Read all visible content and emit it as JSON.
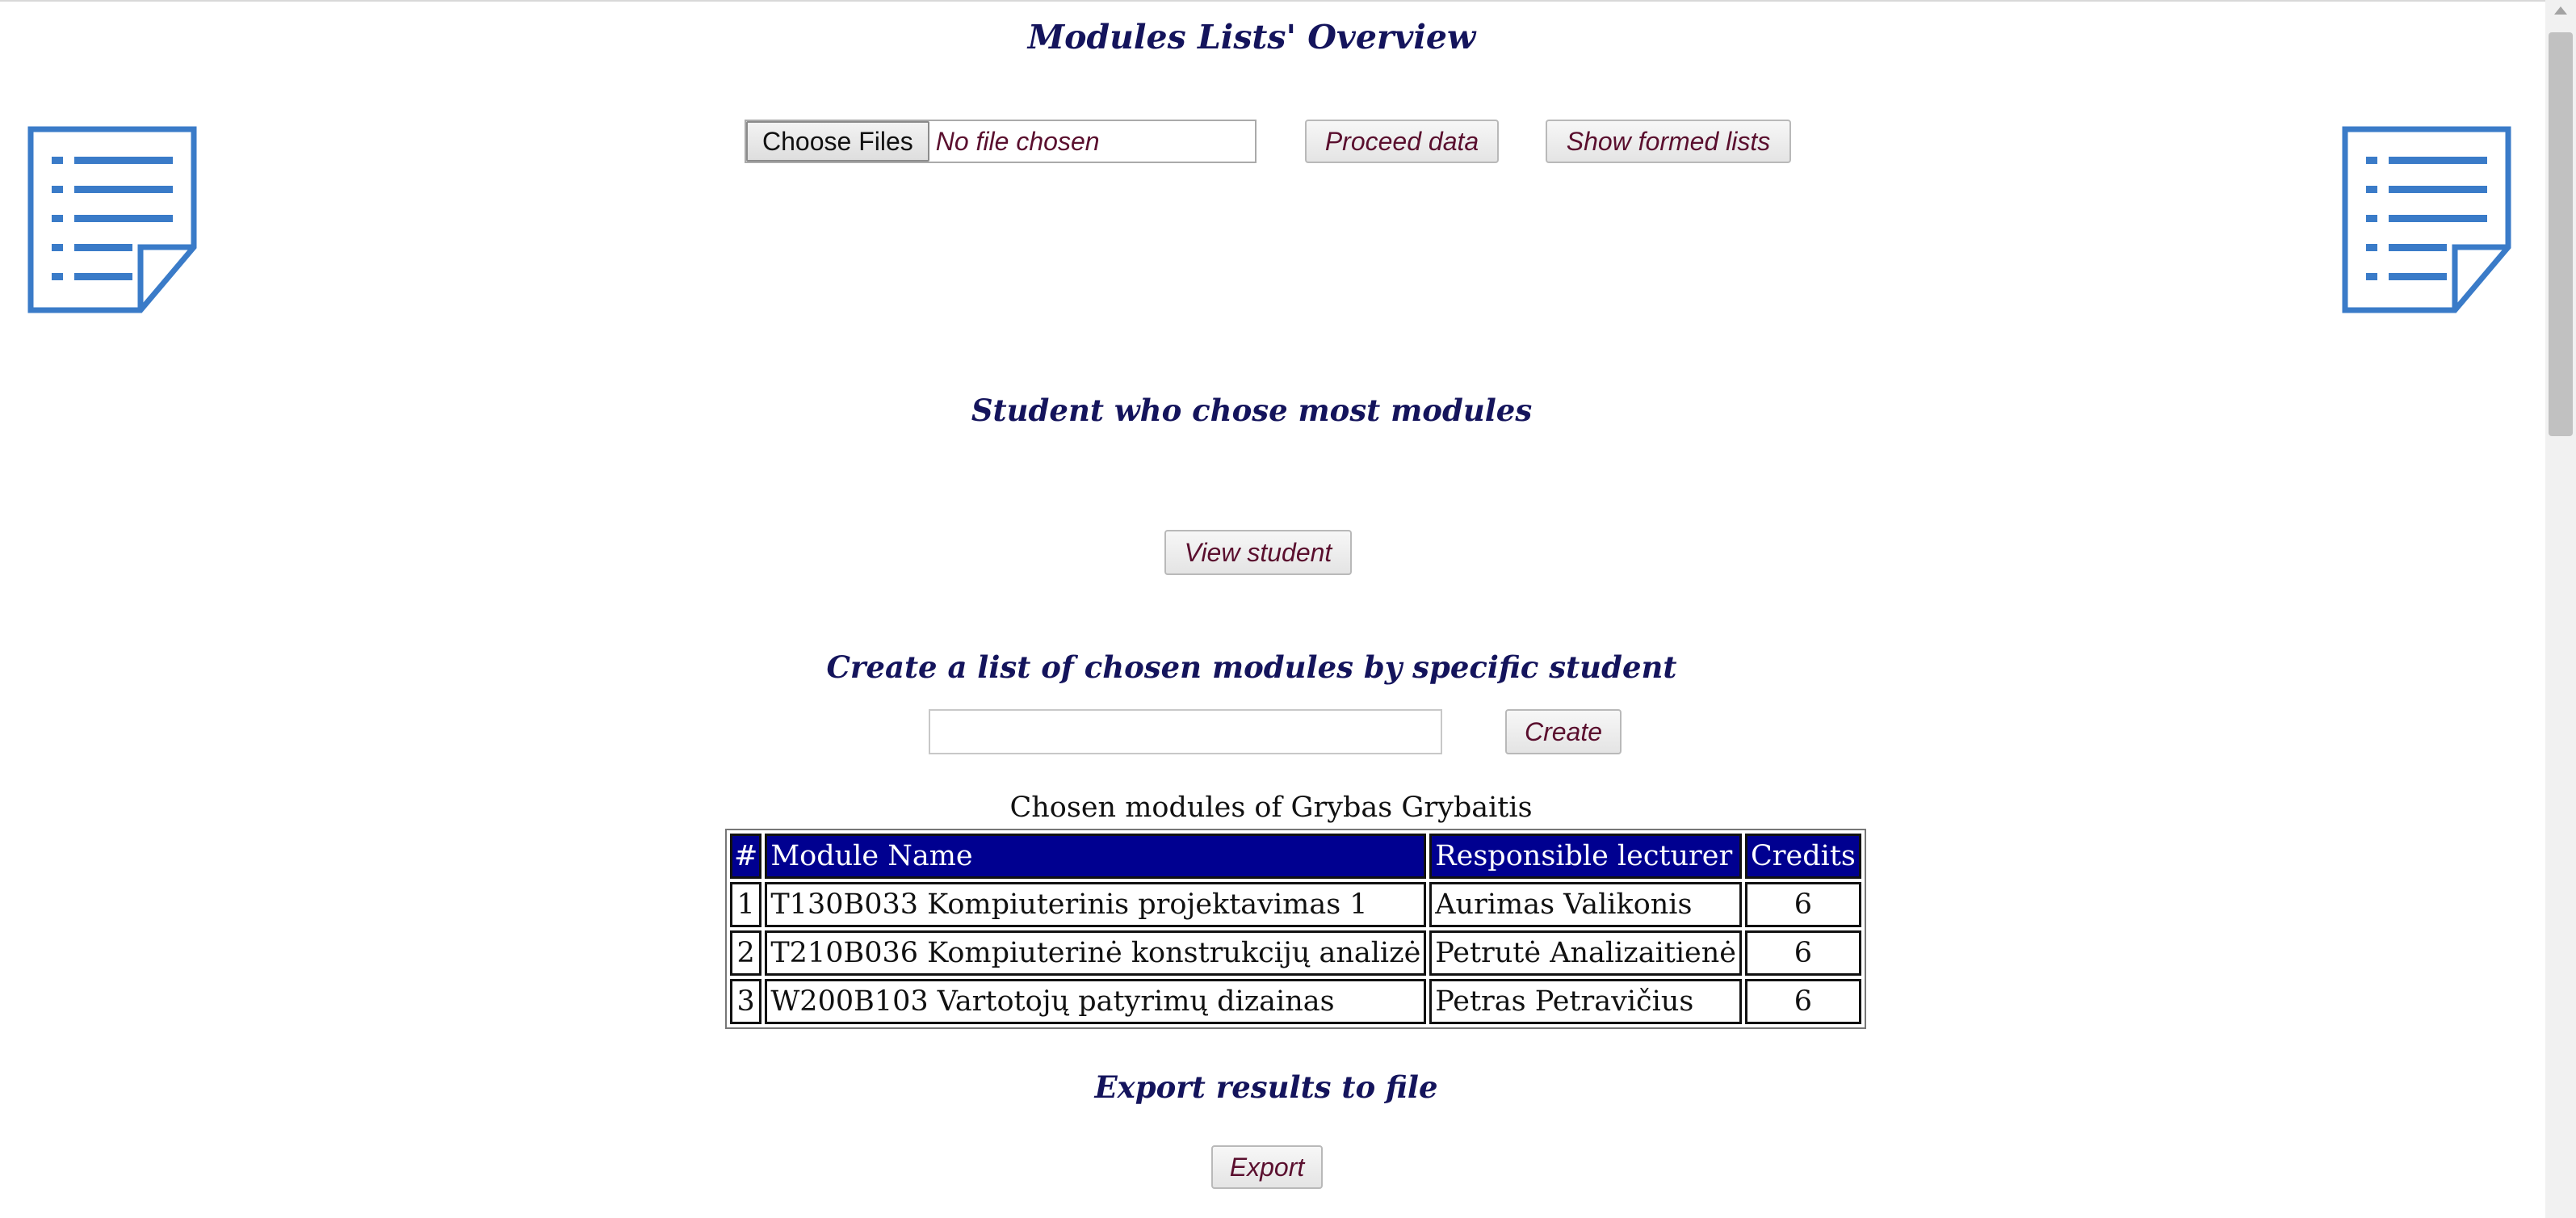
{
  "page": {
    "title": "Modules Lists' Overview"
  },
  "upload": {
    "choose_files_label": "Choose Files",
    "file_status": "No file chosen",
    "proceed_label": "Proceed data",
    "show_lists_label": "Show formed lists"
  },
  "most_modules": {
    "heading": "Student who chose most modules",
    "view_label": "View student"
  },
  "create_list": {
    "heading": "Create a list of chosen modules by specific student",
    "input_value": "",
    "create_label": "Create"
  },
  "results": {
    "caption": "Chosen modules of Grybas Grybaitis",
    "headers": {
      "num": "#",
      "module": "Module Name",
      "lecturer": "Responsible lecturer",
      "credits": "Credits"
    },
    "rows": [
      {
        "num": "1",
        "module": "T130B033 Kompiuterinis projektavimas 1",
        "lecturer": "Aurimas Valikonis",
        "credits": "6"
      },
      {
        "num": "2",
        "module": "T210B036 Kompiuterinė konstrukcijų analizė",
        "lecturer": "Petrutė Analizaitienė",
        "credits": "6"
      },
      {
        "num": "3",
        "module": "W200B103 Vartotojų patyrimų dizainas",
        "lecturer": "Petras Petravičius",
        "credits": "6"
      }
    ]
  },
  "export": {
    "heading": "Export results to file",
    "export_label": "Export"
  },
  "icons": {
    "left_icon": "document-list-icon",
    "right_icon": "document-list-icon",
    "icon_color": "#3a7bc8"
  },
  "colors": {
    "heading": "#14145c",
    "button_text": "#5a0f2e",
    "table_header_bg": "#000090"
  }
}
